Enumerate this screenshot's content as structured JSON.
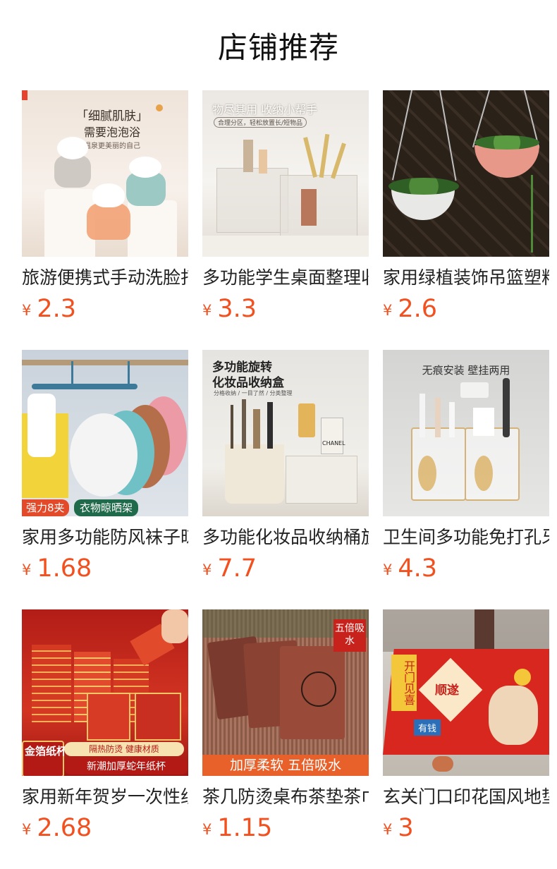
{
  "page": {
    "title": "店铺推荐"
  },
  "products": [
    {
      "name": "旅游便携式手动洗脸打泡器",
      "currency": "¥",
      "price": "2.3",
      "image": {
        "icon": "bubble-cup-product-photo",
        "colors": [
          "#f1e6de",
          "#fbf7f3",
          "#eaa27a"
        ],
        "captions": [
          "「细腻肌肤」",
          "需要泡泡浴",
          "温泉更美丽的自己"
        ]
      }
    },
    {
      "name": "多功能学生桌面整理收纳盒",
      "currency": "¥",
      "price": "3.3",
      "image": {
        "icon": "makeup-organizer-photo",
        "colors": [
          "#ede9e4",
          "#f7f5f2",
          "#d8cfc6"
        ],
        "captions": [
          "物尽其用 收纳小帮手",
          "合理分区，轻松放置长/短物品"
        ]
      }
    },
    {
      "name": "家用绿植装饰吊篮塑料花盆",
      "currency": "¥",
      "price": "2.6",
      "image": {
        "icon": "hanging-planter-photo",
        "colors": [
          "#2a2018",
          "#4a3a2e",
          "#e59a8c"
        ],
        "captions": []
      }
    },
    {
      "name": "家用多功能防风袜子晾晒架",
      "currency": "¥",
      "price": "1.68",
      "image": {
        "icon": "sock-hanger-photo",
        "colors": [
          "#cfd6de",
          "#f2c96a",
          "#e6a0a8"
        ],
        "captions": [
          "强力8夹",
          "衣物晾晒架"
        ]
      }
    },
    {
      "name": "多功能化妆品收纳桶旋转",
      "currency": "¥",
      "price": "7.7",
      "image": {
        "icon": "rotating-cosmetic-box-photo",
        "colors": [
          "#e8e6e2",
          "#f3f1ec",
          "#cbbfae"
        ],
        "captions": [
          "多功能旋转",
          "化妆品收纳盒",
          "分格收纳 / 一目了然 / 分类整理"
        ]
      }
    },
    {
      "name": "卫生间多功能免打孔牙刷架",
      "currency": "¥",
      "price": "4.3",
      "image": {
        "icon": "toothbrush-cup-holder-photo",
        "colors": [
          "#d9d9d8",
          "#eeeeec",
          "#d4b27a"
        ],
        "captions": [
          "无痕安装 壁挂两用"
        ]
      }
    },
    {
      "name": "家用新年贺岁一次性纸杯",
      "currency": "¥",
      "price": "2.68",
      "image": {
        "icon": "new-year-paper-cups-photo",
        "colors": [
          "#c7231c",
          "#e24a2c",
          "#f6d27a"
        ],
        "captions": [
          "金箔纸杯",
          "隔热防烫 健康材质",
          "新潮加厚蛇年纸杯"
        ]
      }
    },
    {
      "name": "茶几防烫桌布茶垫茶巾",
      "currency": "¥",
      "price": "1.15",
      "image": {
        "icon": "tea-towel-photo",
        "colors": [
          "#7a4a3a",
          "#a05a48",
          "#e8612a"
        ],
        "captions": [
          "五倍吸水",
          "加厚柔软 五倍吸水"
        ]
      }
    },
    {
      "name": "玄关门口印花国风地垫",
      "currency": "¥",
      "price": "3",
      "image": {
        "icon": "door-mat-photo",
        "colors": [
          "#d8271f",
          "#f4c63a",
          "#2a6fb8"
        ],
        "captions": [
          "开门见喜",
          "顺遂",
          "有钱"
        ]
      }
    }
  ]
}
